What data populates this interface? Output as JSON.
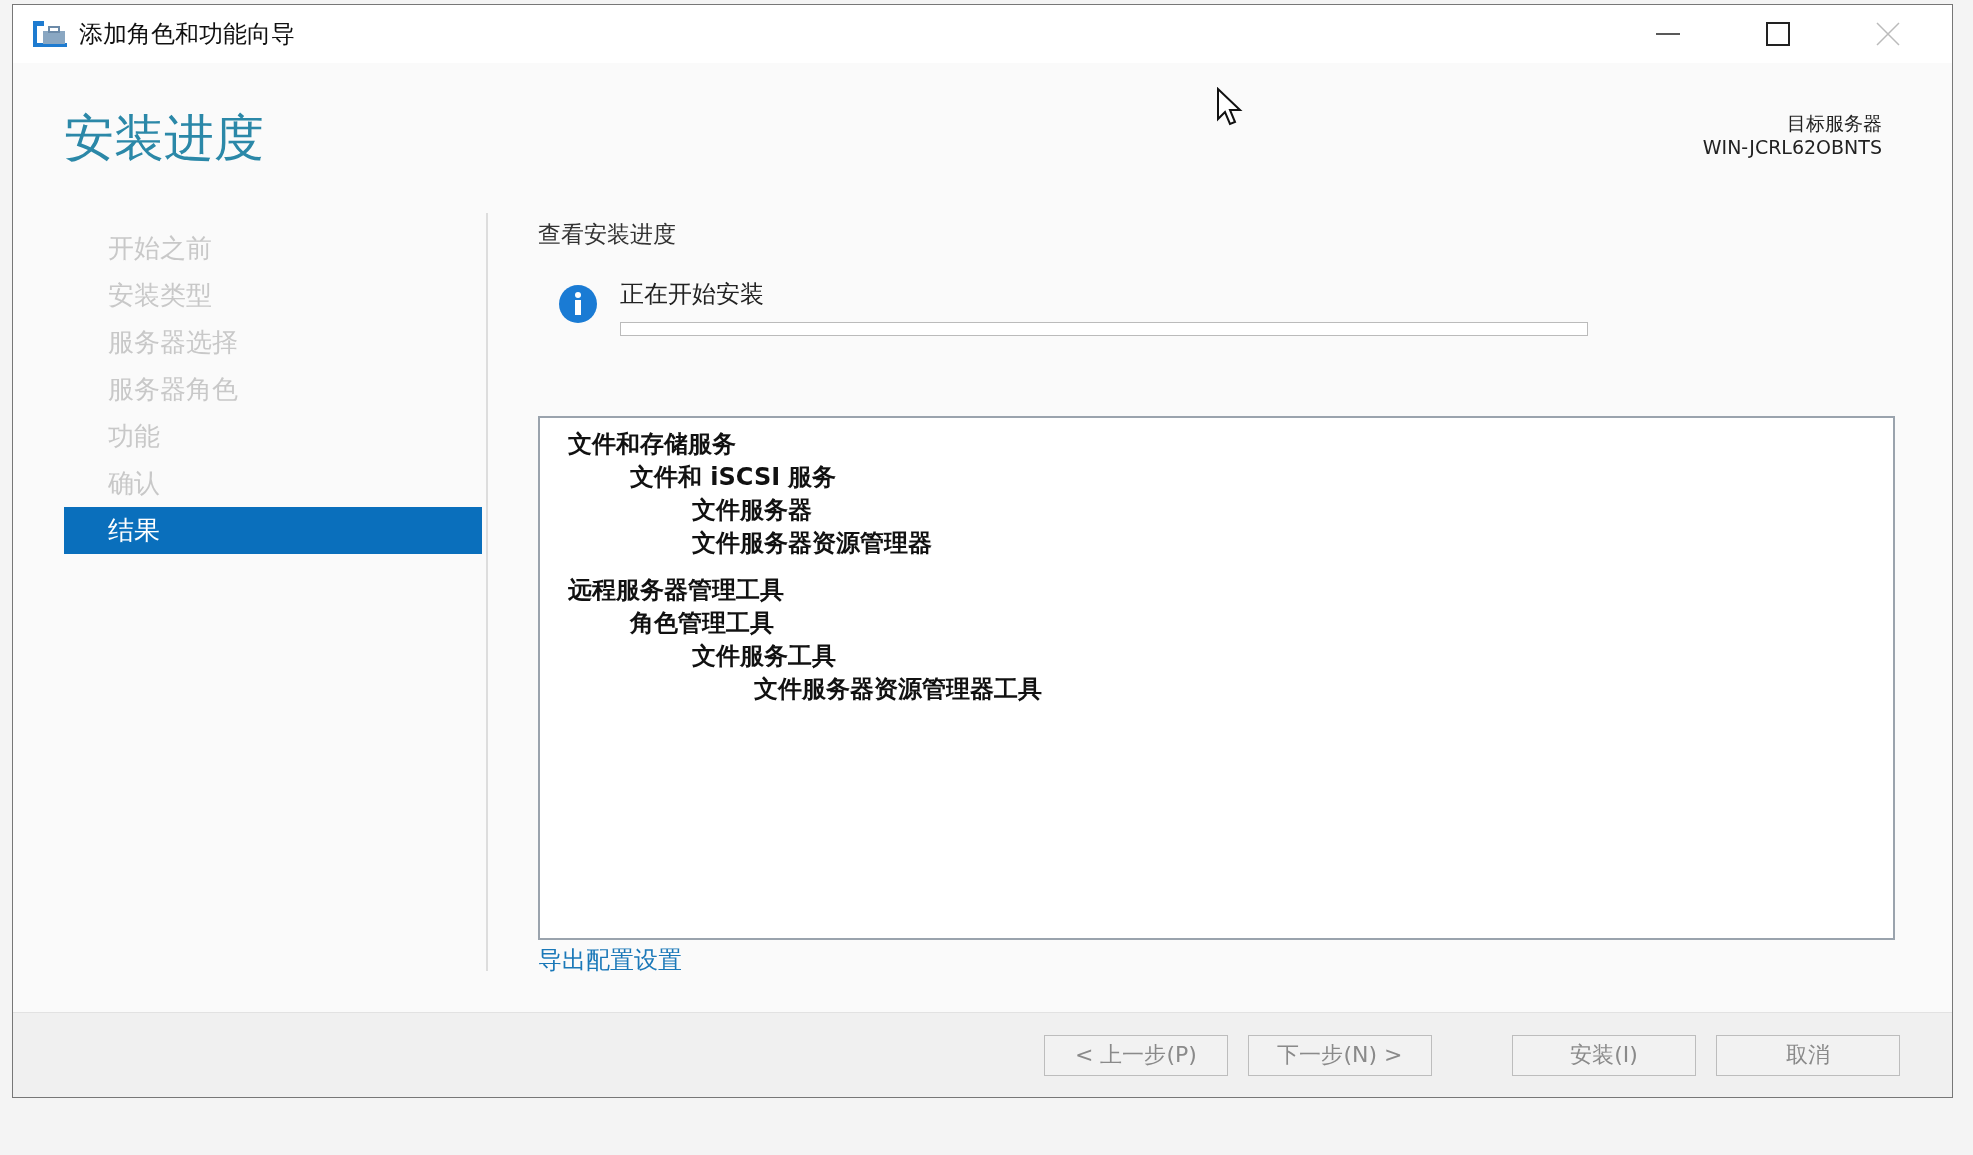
{
  "window": {
    "title": "添加角色和功能向导"
  },
  "page_title": "安装进度",
  "target_server": {
    "label": "目标服务器",
    "name": "WIN-JCRL62OBNTS"
  },
  "steps": [
    {
      "label": "开始之前",
      "selected": false
    },
    {
      "label": "安装类型",
      "selected": false
    },
    {
      "label": "服务器选择",
      "selected": false
    },
    {
      "label": "服务器角色",
      "selected": false
    },
    {
      "label": "功能",
      "selected": false
    },
    {
      "label": "确认",
      "selected": false
    },
    {
      "label": "结果",
      "selected": true
    }
  ],
  "section_title": "查看安装进度",
  "status": {
    "text": "正在开始安装",
    "level": 0
  },
  "features": [
    {
      "label": "文件和存储服务",
      "children": [
        {
          "label": "文件和 iSCSI 服务",
          "children": [
            {
              "label": "文件服务器"
            },
            {
              "label": "文件服务器资源管理器"
            }
          ]
        }
      ]
    },
    {
      "label": "远程服务器管理工具",
      "children": [
        {
          "label": "角色管理工具",
          "children": [
            {
              "label": "文件服务工具",
              "children": [
                {
                  "label": "文件服务器资源管理器工具"
                }
              ]
            }
          ]
        }
      ]
    }
  ],
  "export_link": "导出配置设置",
  "buttons": [
    {
      "label": "< 上一步(P)",
      "disabled": true
    },
    {
      "label": "下一步(N) >",
      "disabled": true
    },
    {
      "label": "安装(I)",
      "disabled": true
    },
    {
      "label": "取消",
      "disabled": true
    }
  ]
}
